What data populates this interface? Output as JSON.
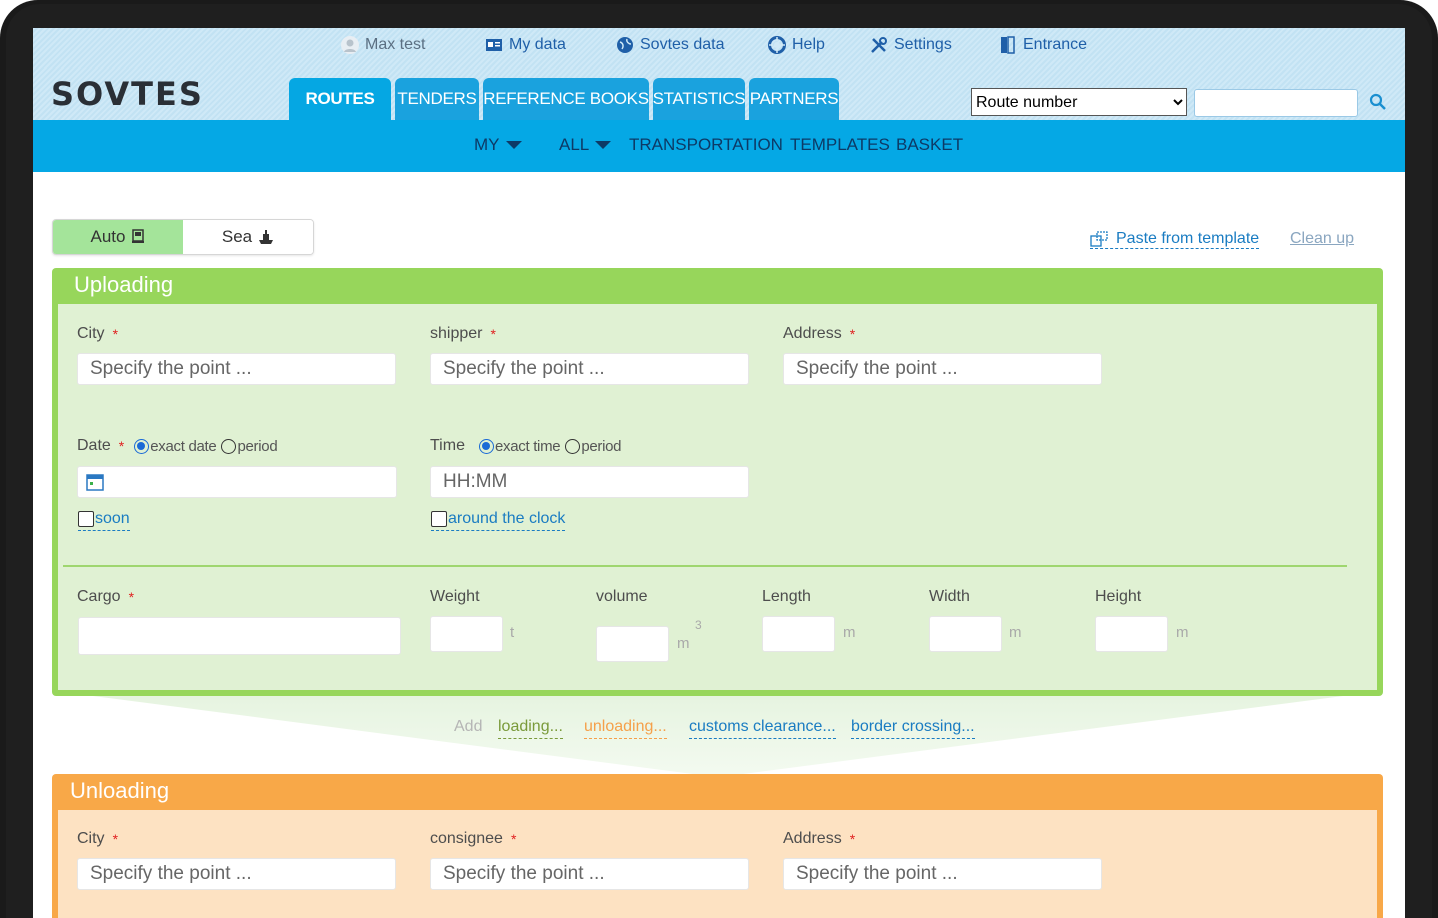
{
  "topnav": {
    "user": "Max test",
    "my_data": "My data",
    "sovtes_data": "Sovtes data",
    "help": "Help",
    "settings": "Settings",
    "entrance": "Entrance"
  },
  "logo": "SOVTES",
  "tabs": [
    "ROUTES",
    "TENDERS",
    "REFERENCE BOOKS",
    "STATISTICS",
    "PARTNERS"
  ],
  "search": {
    "selected": "Route number",
    "value": ""
  },
  "subnav": {
    "my": "MY",
    "all": "ALL",
    "transportation": "TRANSPORTATION",
    "templates": "TEMPLATES",
    "basket": "BASKET"
  },
  "transport": {
    "auto": "Auto",
    "sea": "Sea"
  },
  "actions": {
    "paste": "Paste from template",
    "clean": "Clean up"
  },
  "uploading": {
    "title": "Uploading",
    "city_label": "City",
    "city_placeholder": "Specify the point ...",
    "shipper_label": "shipper",
    "shipper_placeholder": "Specify the point ...",
    "address_label": "Address",
    "address_placeholder": "Specify the point ...",
    "date_label": "Date",
    "date_exact": "exact date",
    "date_period": "period",
    "soon": "soon",
    "time_label": "Time",
    "time_exact": "exact time",
    "time_period": "period",
    "time_placeholder": "HH:MM",
    "around_clock": "around the clock",
    "cargo_label": "Cargo",
    "weight_label": "Weight",
    "weight_unit": "t",
    "volume_label": "volume",
    "volume_unit": "m",
    "volume_sup": "3",
    "length_label": "Length",
    "length_unit": "m",
    "width_label": "Width",
    "width_unit": "m",
    "height_label": "Height",
    "height_unit": "m"
  },
  "add": {
    "label": "Add",
    "loading": "loading...",
    "unloading": "unloading...",
    "customs": "customs clearance...",
    "border": "border crossing..."
  },
  "unloading": {
    "title": "Unloading",
    "city_label": "City",
    "city_placeholder": "Specify the point ...",
    "consignee_label": "consignee",
    "consignee_placeholder": "Specify the point ...",
    "address_label": "Address",
    "address_placeholder": "Specify the point ..."
  },
  "required_mark": "*",
  "colors": {
    "accent": "#05a8e5",
    "uploading": "#97d65b",
    "unloading": "#f8a848"
  }
}
